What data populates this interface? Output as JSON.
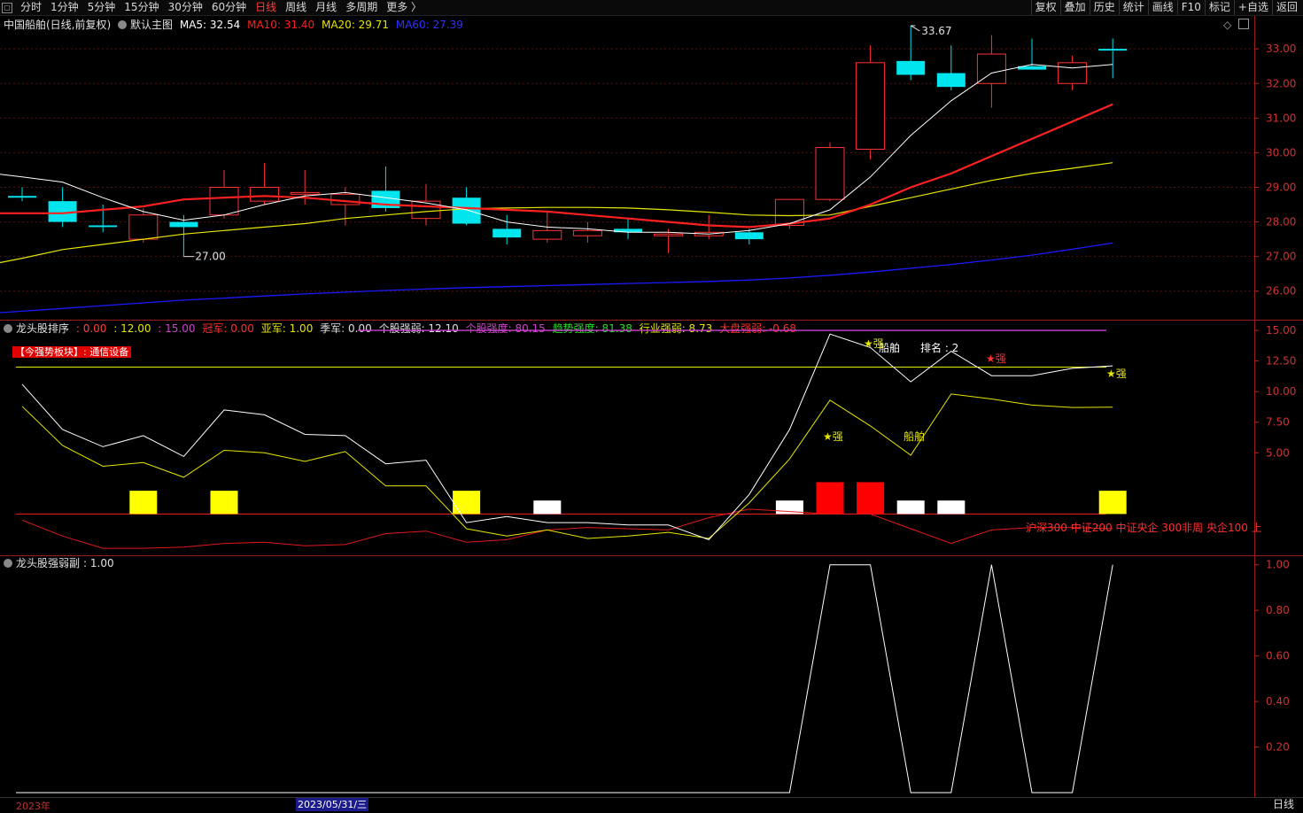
{
  "toolbar": {
    "left_items": [
      "分时",
      "1分钟",
      "5分钟",
      "15分钟",
      "30分钟",
      "60分钟",
      "日线",
      "周线",
      "月线",
      "多周期",
      "更多 〉"
    ],
    "active_index": 6,
    "right_items": [
      "复权",
      "叠加",
      "历史",
      "统计",
      "画线",
      "F10",
      "标记",
      "+自选",
      "返回"
    ]
  },
  "main_panel": {
    "stock_title": "中国船舶(日线,前复权)",
    "indicator_name": "默认主图",
    "ma5": "MA5: 32.54",
    "ma10": "MA10: 31.40",
    "ma20": "MA20: 29.71",
    "ma60": "MA60: 27.39",
    "high_label": "33.67",
    "low_label": "27.00",
    "y_ticks": [
      "33.00",
      "32.00",
      "31.00",
      "30.00",
      "29.00",
      "28.00",
      "27.00",
      "26.00"
    ]
  },
  "mid_panel": {
    "name": "龙头股排序",
    "v1": ": 0.00",
    "v2": ": 12.00",
    "v3": ": 15.00",
    "champ": "冠军: 0.00",
    "runner": "亚军: 1.00",
    "third": "季军: 0.00",
    "stock_strength": "个股强弱: 12.10",
    "stock_intensity": "个股强度: 80.15",
    "trend_intensity": "趋势强度: 81.38",
    "industry_strength": "行业强弱: 8.73",
    "market_strength": "大盘强弱: -0.68",
    "sector_tag": "【今强势板块】: 通信设备",
    "label_chuanbo1": "船舶",
    "label_rank": "排名 : 2",
    "label_chuanbo2": "船舶",
    "label_strong": "强",
    "star_strong": "★强",
    "scroll_text": "沪深300 中证200 中证央企 300非周 央企100 上",
    "y_ticks": [
      "15.00",
      "12.50",
      "10.00",
      "7.50",
      "5.00"
    ]
  },
  "low_panel": {
    "name": "龙头股强弱副",
    "value": ": 1.00",
    "y_ticks": [
      "1.00",
      "0.80",
      "0.60",
      "0.40",
      "0.20"
    ]
  },
  "bottom": {
    "year": "2023年",
    "cursor_date": "2023/05/31/三",
    "period": "日线"
  },
  "colors": {
    "up": "#ff3232",
    "down": "#00e5ee",
    "ma5": "#ffffff",
    "ma10": "#ff2020",
    "ma20": "#e6e600",
    "ma60": "#1a1aff",
    "purple": "#d040d0"
  },
  "chart_data": [
    {
      "type": "candlestick",
      "title": "中国船舶(日线,前复权)",
      "ylim": [
        25.2,
        33.9
      ],
      "candles": [
        {
          "o": 28.75,
          "h": 29.0,
          "l": 28.6,
          "c": 28.7
        },
        {
          "o": 28.6,
          "h": 29.0,
          "l": 27.85,
          "c": 28.0
        },
        {
          "o": 27.9,
          "h": 28.5,
          "l": 27.7,
          "c": 27.85
        },
        {
          "o": 27.5,
          "h": 28.4,
          "l": 27.4,
          "c": 28.2
        },
        {
          "o": 28.0,
          "h": 28.2,
          "l": 27.0,
          "c": 27.85
        },
        {
          "o": 28.2,
          "h": 29.5,
          "l": 28.1,
          "c": 29.0
        },
        {
          "o": 28.6,
          "h": 29.7,
          "l": 28.5,
          "c": 29.0
        },
        {
          "o": 28.8,
          "h": 29.5,
          "l": 28.5,
          "c": 28.85
        },
        {
          "o": 28.5,
          "h": 29.0,
          "l": 27.9,
          "c": 28.8
        },
        {
          "o": 28.9,
          "h": 29.6,
          "l": 28.3,
          "c": 28.4
        },
        {
          "o": 28.1,
          "h": 29.1,
          "l": 27.9,
          "c": 28.6
        },
        {
          "o": 28.7,
          "h": 29.0,
          "l": 27.9,
          "c": 27.95
        },
        {
          "o": 27.8,
          "h": 28.2,
          "l": 27.35,
          "c": 27.55
        },
        {
          "o": 27.5,
          "h": 28.3,
          "l": 27.4,
          "c": 27.75
        },
        {
          "o": 27.6,
          "h": 28.0,
          "l": 27.4,
          "c": 27.75
        },
        {
          "o": 27.8,
          "h": 28.1,
          "l": 27.5,
          "c": 27.7
        },
        {
          "o": 27.6,
          "h": 27.8,
          "l": 27.1,
          "c": 27.65
        },
        {
          "o": 27.6,
          "h": 28.2,
          "l": 27.5,
          "c": 27.7
        },
        {
          "o": 27.7,
          "h": 27.8,
          "l": 27.35,
          "c": 27.5
        },
        {
          "o": 27.9,
          "h": 28.6,
          "l": 27.8,
          "c": 28.65
        },
        {
          "o": 28.65,
          "h": 30.3,
          "l": 28.6,
          "c": 30.15
        },
        {
          "o": 30.1,
          "h": 33.1,
          "l": 29.8,
          "c": 32.6
        },
        {
          "o": 32.65,
          "h": 33.67,
          "l": 32.1,
          "c": 32.25
        },
        {
          "o": 32.3,
          "h": 33.1,
          "l": 31.8,
          "c": 31.9
        },
        {
          "o": 32.0,
          "h": 33.4,
          "l": 31.3,
          "c": 32.85
        },
        {
          "o": 32.5,
          "h": 33.3,
          "l": 32.4,
          "c": 32.4
        },
        {
          "o": 32.0,
          "h": 32.8,
          "l": 31.8,
          "c": 32.6
        },
        {
          "o": 33.0,
          "h": 33.3,
          "l": 32.15,
          "c": 32.95
        }
      ],
      "ma5": [
        29.3,
        29.15,
        28.7,
        28.3,
        28.05,
        28.2,
        28.5,
        28.75,
        28.85,
        28.7,
        28.55,
        28.35,
        28.0,
        27.85,
        27.8,
        27.7,
        27.7,
        27.65,
        27.75,
        27.95,
        28.35,
        29.3,
        30.5,
        31.5,
        32.3,
        32.55,
        32.45,
        32.55
      ],
      "ma10": [
        28.25,
        28.25,
        28.35,
        28.45,
        28.65,
        28.7,
        28.75,
        28.7,
        28.6,
        28.5,
        28.45,
        28.4,
        28.35,
        28.3,
        28.2,
        28.1,
        28.0,
        27.9,
        27.85,
        27.95,
        28.1,
        28.5,
        29.0,
        29.4,
        29.9,
        30.4,
        30.9,
        31.4
      ],
      "ma20": [
        26.95,
        27.2,
        27.35,
        27.5,
        27.65,
        27.75,
        27.85,
        27.95,
        28.1,
        28.2,
        28.3,
        28.38,
        28.4,
        28.42,
        28.42,
        28.4,
        28.35,
        28.28,
        28.2,
        28.18,
        28.2,
        28.45,
        28.7,
        28.95,
        29.2,
        29.4,
        29.55,
        29.71
      ],
      "ma60": [
        25.42,
        25.5,
        25.58,
        25.66,
        25.74,
        25.8,
        25.86,
        25.92,
        25.97,
        26.02,
        26.06,
        26.1,
        26.13,
        26.16,
        26.19,
        26.22,
        26.25,
        26.28,
        26.32,
        26.38,
        26.46,
        26.55,
        26.66,
        26.77,
        26.9,
        27.04,
        27.21,
        27.39
      ]
    },
    {
      "type": "line",
      "title": "龙头股排序",
      "ylim": [
        -3.3,
        15.8
      ],
      "white": [
        10.6,
        6.9,
        5.5,
        6.4,
        4.7,
        8.5,
        8.1,
        6.5,
        6.4,
        4.1,
        4.4,
        -0.7,
        -0.2,
        -0.7,
        -0.7,
        -0.9,
        -0.9,
        -2.1,
        1.6,
        6.9,
        14.7,
        13.6,
        10.8,
        13.3,
        11.3,
        11.3,
        11.9,
        12.1
      ],
      "yellow": [
        8.8,
        5.6,
        3.9,
        4.2,
        3.0,
        5.2,
        5.0,
        4.3,
        5.1,
        2.3,
        2.3,
        -1.2,
        -1.8,
        -1.3,
        -2.0,
        -1.8,
        -1.5,
        -2.0,
        0.9,
        4.5,
        9.3,
        7.2,
        4.8,
        9.8,
        9.4,
        8.9,
        8.7,
        8.73
      ],
      "red": [
        -0.5,
        -1.8,
        -2.8,
        -2.8,
        -2.7,
        -2.4,
        -2.3,
        -2.6,
        -2.5,
        -1.6,
        -1.4,
        -2.3,
        -2.1,
        -1.3,
        -1.1,
        -1.2,
        -1.3,
        -0.3,
        0.4,
        0.2,
        0.0,
        0.0,
        -1.2,
        -2.4,
        -1.3,
        -1.1,
        -1.1,
        -1.2
      ],
      "hlines": {
        "purple": 15.0,
        "yellow": 12.0,
        "red": 0.0
      },
      "bars": [
        {
          "i": 3,
          "color": "yellow",
          "v": 1.9
        },
        {
          "i": 5,
          "color": "yellow",
          "v": 1.9
        },
        {
          "i": 11,
          "color": "yellow",
          "v": 1.9
        },
        {
          "i": 13,
          "color": "white",
          "v": 1.1
        },
        {
          "i": 19,
          "color": "white",
          "v": 1.1
        },
        {
          "i": 20,
          "color": "red",
          "v": 2.6
        },
        {
          "i": 21,
          "color": "red",
          "v": 2.6
        },
        {
          "i": 22,
          "color": "white",
          "v": 1.1
        },
        {
          "i": 23,
          "color": "white",
          "v": 1.1
        },
        {
          "i": 27,
          "color": "yellow",
          "v": 1.9
        }
      ]
    },
    {
      "type": "line",
      "title": "龙头股强弱副",
      "ylim": [
        0,
        1.03
      ],
      "values": [
        0,
        0,
        0,
        0,
        0,
        0,
        0,
        0,
        0,
        0,
        0,
        0,
        0,
        0,
        0,
        0,
        0,
        0,
        0,
        0,
        1,
        1,
        0,
        0,
        1,
        0,
        0,
        1
      ]
    }
  ]
}
